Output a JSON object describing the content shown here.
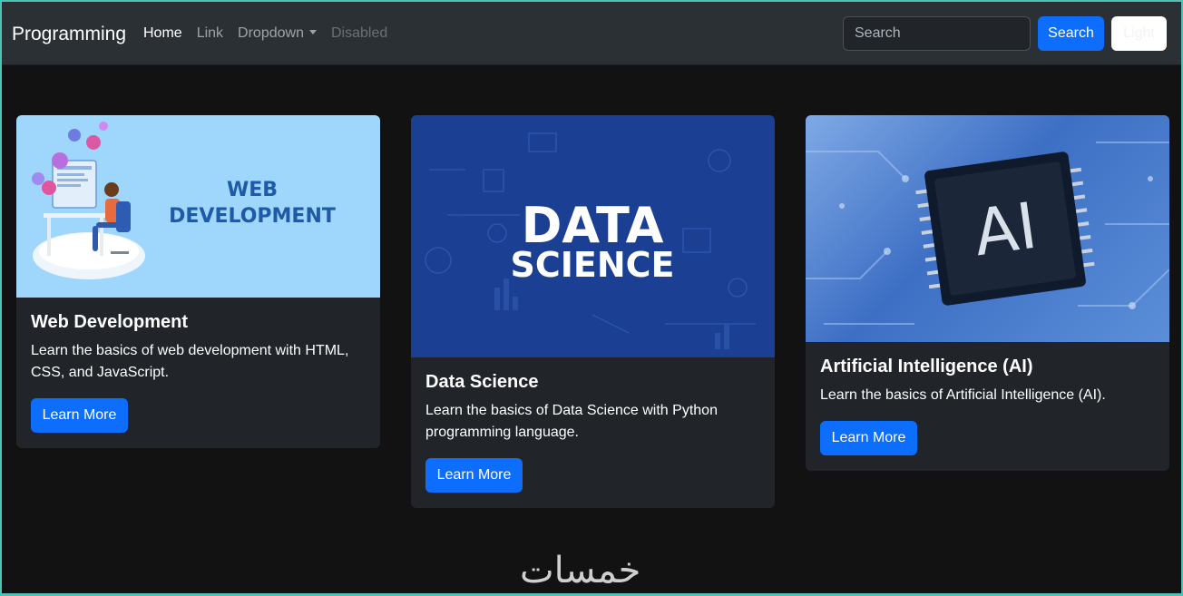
{
  "navbar": {
    "brand": "Programming",
    "links": [
      {
        "label": "Home"
      },
      {
        "label": "Link"
      },
      {
        "label": "Dropdown"
      },
      {
        "label": "Disabled"
      }
    ],
    "search_placeholder": "Search",
    "search_button": "Search",
    "theme_button": "Light"
  },
  "cards": [
    {
      "image_text": [
        "WEB",
        "DEVELOPMENT"
      ],
      "title": "Web Development",
      "text": "Learn the basics of web development with HTML, CSS, and JavaScript.",
      "button": "Learn More"
    },
    {
      "image_text": [
        "DATA",
        "SCIENCE"
      ],
      "title": "Data Science",
      "text": "Learn the basics of Data Science with Python programming language.",
      "button": "Learn More"
    },
    {
      "image_text": [
        "AI"
      ],
      "title": "Artificial Intelligence (AI)",
      "text": "Learn the basics of Artificial Intelligence (AI).",
      "button": "Learn More"
    }
  ],
  "watermark": "خمسات",
  "colors": {
    "primary": "#0d6efd",
    "navbar": "#2b3035",
    "card": "#212529",
    "body": "#121212"
  }
}
